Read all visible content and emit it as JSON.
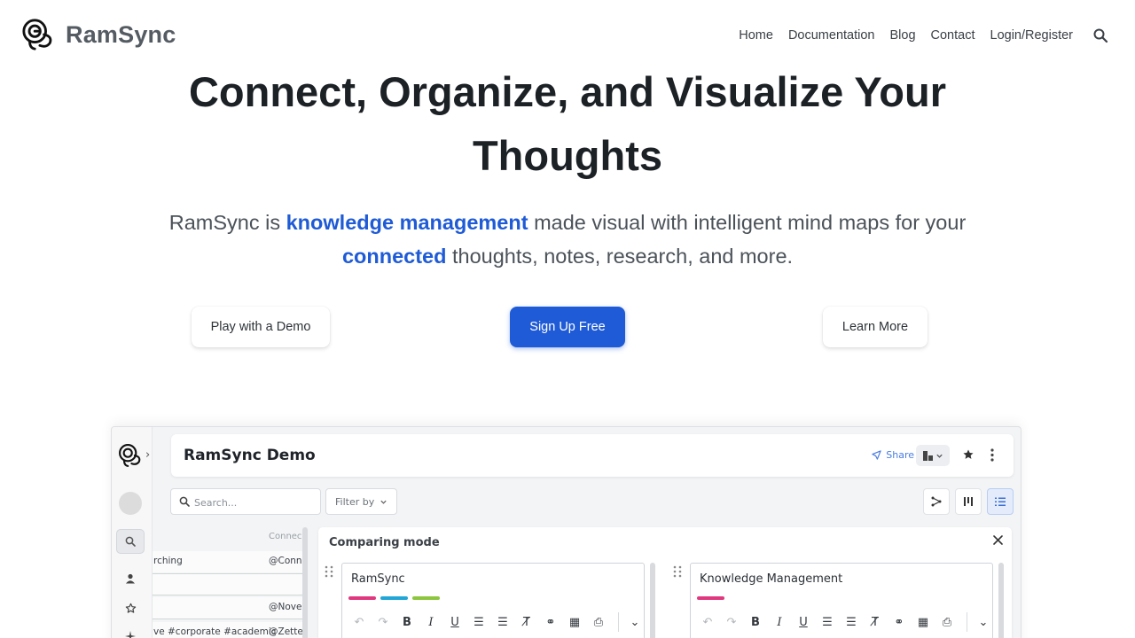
{
  "nav": {
    "brand": "RamSync",
    "links": [
      "Home",
      "Documentation",
      "Blog",
      "Contact",
      "Login/Register"
    ],
    "search_icon": "search-icon"
  },
  "hero": {
    "title": "Connect, Organize, and Visualize Your Thoughts",
    "sub_part1": "RamSync is ",
    "sub_hl1": "knowledge management",
    "sub_part2": " made visual with intelligent mind maps for your ",
    "sub_hl2": "connected",
    "sub_part3": " thoughts, notes, research, and more.",
    "cta_demo": "Play with a Demo",
    "cta_signup": "Sign Up Free",
    "cta_learn": "Learn More"
  },
  "demo": {
    "title": "RamSync Demo",
    "share": "Share",
    "search_placeholder": "Search...",
    "filter": "Filter by",
    "list_header": "Connec",
    "rows": [
      {
        "left": "rching",
        "right": "@Conn"
      },
      {
        "left": "",
        "right": ""
      },
      {
        "left": "",
        "right": "@Nove"
      },
      {
        "left": "ve #corporate #academic",
        "right": "@Zette"
      }
    ],
    "compare_title": "Comparing mode",
    "cards": [
      {
        "title": "RamSync",
        "tags": [
          "#e0387e",
          "#22a6d6",
          "#8cc63f"
        ]
      },
      {
        "title": "Knowledge Management",
        "tags": [
          "#e0387e"
        ]
      }
    ]
  },
  "colors": {
    "accent": "#1f5bd6",
    "brand_text": "#545b62"
  }
}
